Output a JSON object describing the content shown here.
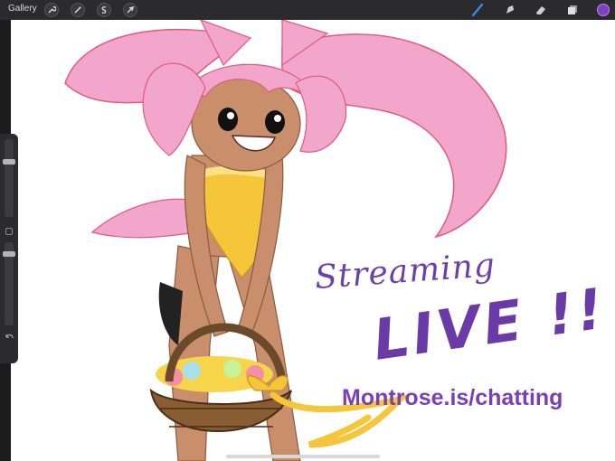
{
  "topbar": {
    "gallery_label": "Gallery",
    "left_tools": [
      "wrench-icon",
      "magic-wand-icon",
      "selection-s-icon",
      "transform-arrow-icon"
    ],
    "right_tools": [
      "brush-icon",
      "smudge-icon",
      "eraser-icon",
      "layers-icon"
    ],
    "active_color": "#7e3fc4"
  },
  "artwork": {
    "line1": "Streaming",
    "line2": "LIVE !!",
    "url": "Montrose.is/chatting"
  },
  "colors": {
    "hair": "#f3a6cb",
    "skin": "#c98f6c",
    "outfit": "#f5c63a",
    "basket": "#6b4a2b",
    "text": "#6d3fa8"
  }
}
